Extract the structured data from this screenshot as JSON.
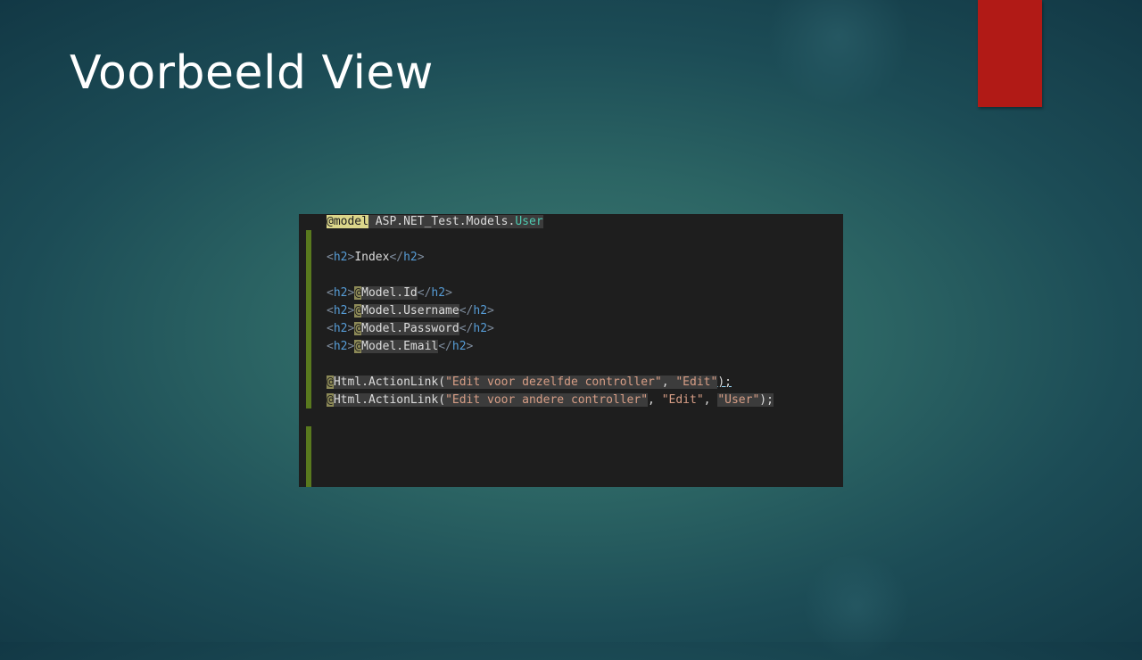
{
  "slide": {
    "title": "Voorbeeld View",
    "accent_color": "#b11a16"
  },
  "code": {
    "line1": {
      "directive": "@model",
      "namespace": "ASP.NET_Test.Models.",
      "type": "User"
    },
    "tag_h2": "h2",
    "index_text": "Index",
    "at": "@",
    "model_id": "Model.Id",
    "model_username": "Model.Username",
    "model_password": "Model.Password",
    "model_email": "Model.Email",
    "link1": {
      "method": "Html.ActionLink(",
      "arg1": "\"Edit voor dezelfde controller\"",
      "sep1": ", ",
      "arg2": "\"Edit\"",
      "close": ");"
    },
    "link2": {
      "method": "Html.ActionLink(",
      "arg1": "\"Edit voor andere controller\"",
      "sep1": ", ",
      "arg2": "\"Edit\"",
      "sep2": ", ",
      "arg3": "\"User\"",
      "close": ");"
    }
  }
}
